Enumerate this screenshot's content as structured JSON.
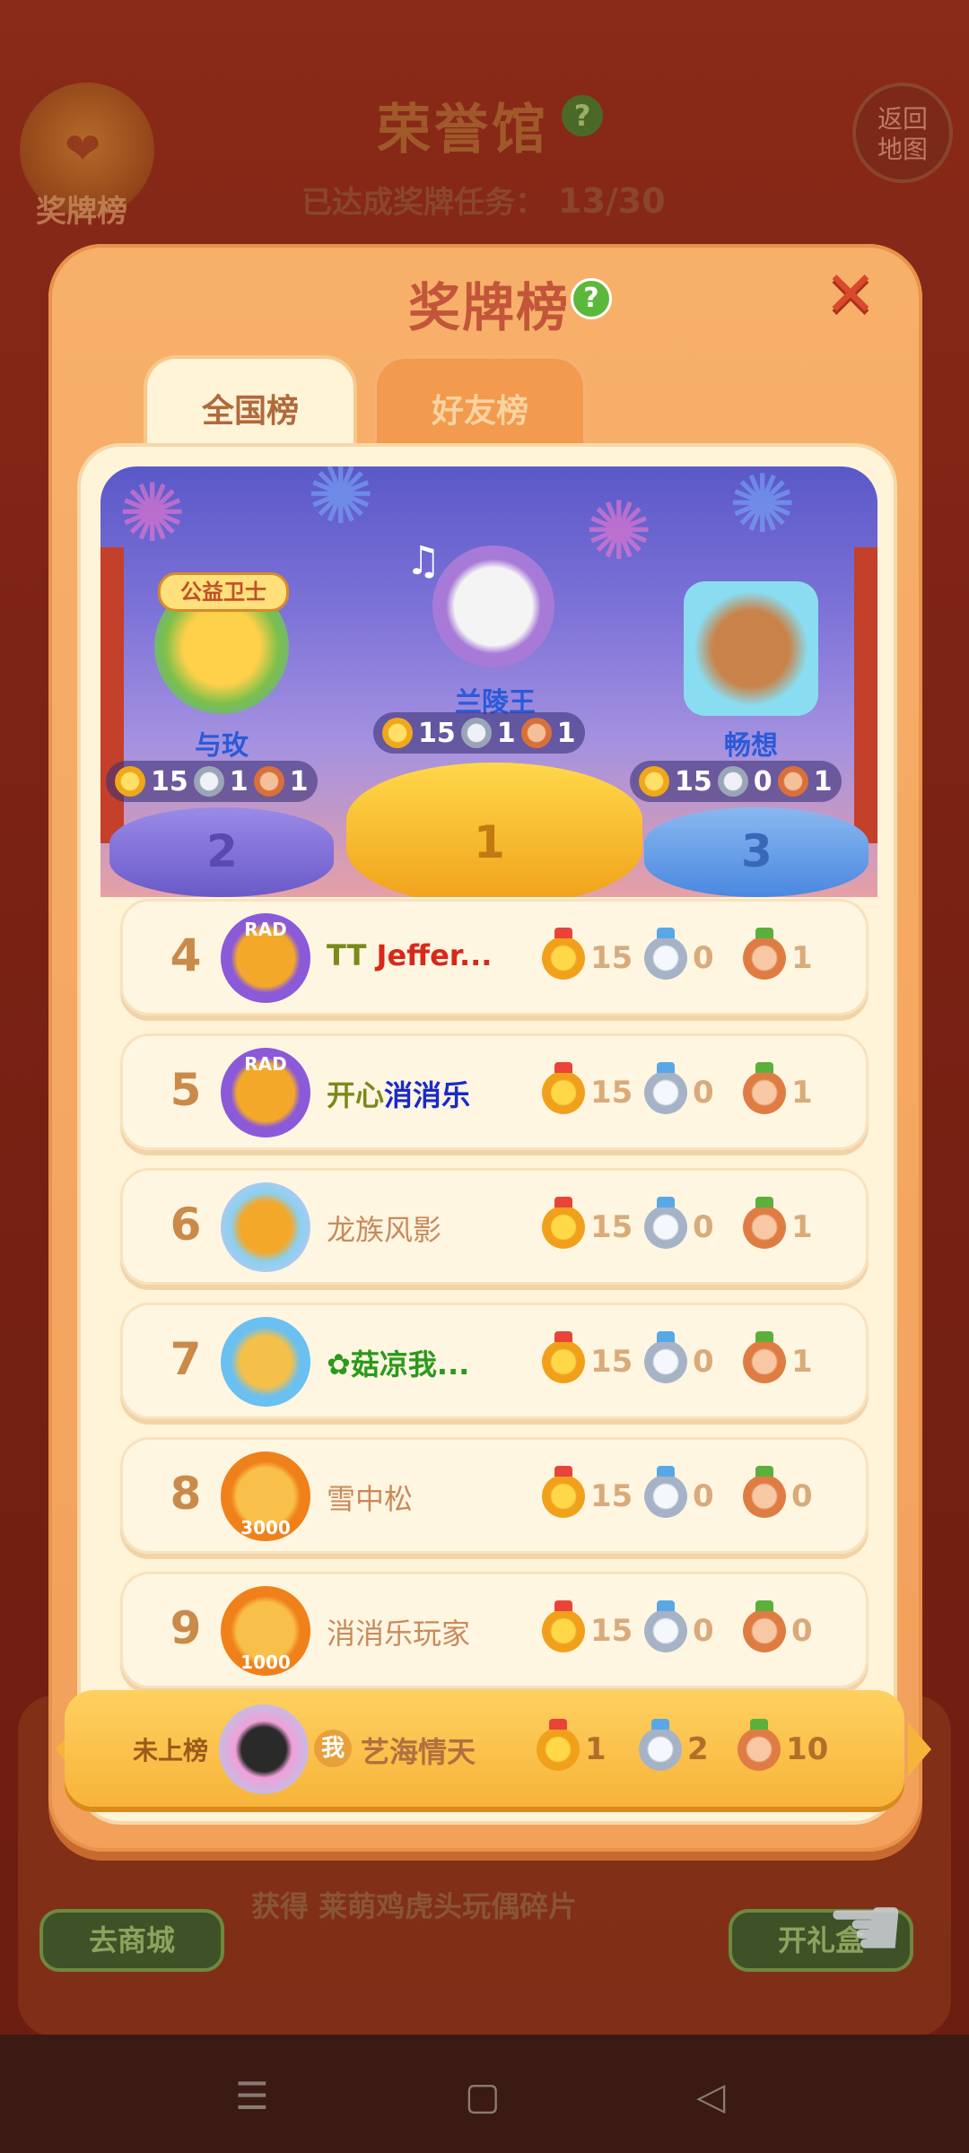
{
  "background": {
    "medal_label": "奖牌榜",
    "title": "荣誉馆",
    "help": "?",
    "return_label_1": "返回",
    "return_label_2": "地图",
    "progress_label": "已达成奖牌任务：",
    "progress_value": "13/30",
    "reward_text": "获得 莱萌鸡虎头玩偶碎片",
    "shop_button": "去商城",
    "gift_button": "开礼盒"
  },
  "dialog": {
    "title": "奖牌榜",
    "help": "?",
    "close": "✕",
    "tabs": [
      {
        "label": "全国榜",
        "active": true
      },
      {
        "label": "好友榜",
        "active": false
      }
    ]
  },
  "podium": {
    "first": {
      "rank": "1",
      "name": "兰陵王",
      "gold": "15",
      "silver": "1",
      "bronze": "1"
    },
    "second": {
      "rank": "2",
      "name": "与玫",
      "badge_text": "公益卫士",
      "gold": "15",
      "silver": "1",
      "bronze": "1"
    },
    "third": {
      "rank": "3",
      "name": "畅想",
      "gold": "15",
      "silver": "0",
      "bronze": "1"
    }
  },
  "rows": [
    {
      "rank": "4",
      "name_a": "TT ",
      "name_b": "Jeffer...",
      "gold": "15",
      "silver": "0",
      "bronze": "1",
      "avatar_text": "RAD"
    },
    {
      "rank": "5",
      "name_a": "开心",
      "name_b": "消消乐",
      "gold": "15",
      "silver": "0",
      "bronze": "1",
      "avatar_text": "RAD"
    },
    {
      "rank": "6",
      "name": "龙族风影",
      "gold": "15",
      "silver": "0",
      "bronze": "1"
    },
    {
      "rank": "7",
      "name": "✿菇凉我...",
      "gold": "15",
      "silver": "0",
      "bronze": "1"
    },
    {
      "rank": "8",
      "name": "雪中松",
      "gold": "15",
      "silver": "0",
      "bronze": "0",
      "avatar_text": "3000"
    },
    {
      "rank": "9",
      "name": "消消乐玩家",
      "gold": "15",
      "silver": "0",
      "bronze": "0",
      "avatar_text": "1000"
    }
  ],
  "self_row": {
    "rank_label": "未上榜",
    "me_badge": "我",
    "name": "艺海情天",
    "gold": "1",
    "silver": "2",
    "bronze": "10"
  },
  "colors": {
    "gold": "#f0a81a",
    "silver": "#9aa6b8",
    "bronze": "#d9703a",
    "name_blue": "#2a5ad8"
  }
}
